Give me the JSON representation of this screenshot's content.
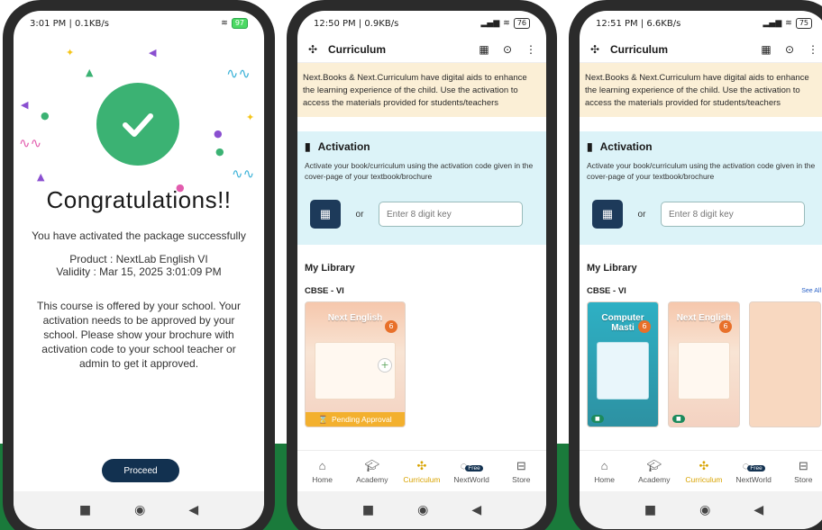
{
  "phone1": {
    "status_time": "3:01 PM | 0.1KB/s",
    "battery": "97",
    "heading": "Congratulations!!",
    "success_text": "You have activated the package successfully",
    "product_line": "Product : NextLab English VI",
    "validity_line": "Validity : Mar 15, 2025 3:01:09 PM",
    "approval_text": "This course is offered by your school. Your activation needs to be approved by your school. Please show your brochure with activation code to your school teacher or admin to get it approved.",
    "proceed_label": "Proceed"
  },
  "phone2": {
    "status_time": "12:50 PM | 0.9KB/s",
    "battery": "76"
  },
  "phone3": {
    "status_time": "12:51 PM | 6.6KB/s",
    "battery": "75"
  },
  "app": {
    "title": "Curriculum",
    "info_banner": "Next.Books & Next.Curriculum have digital aids to enhance the learning experience of the child. Use the activation to access the materials provided for students/teachers",
    "activation_title": "Activation",
    "activation_desc": "Activate your book/curriculum using the activation code given in the cover-page of your textbook/brochure",
    "or_label": "or",
    "key_placeholder": "Enter 8 digit key",
    "library_title": "My Library",
    "cbse_label": "CBSE - VI",
    "see_all": "See All",
    "pending_label": "Pending Approval",
    "book_next_english": "Next English",
    "book_computer_masti": "Computer Masti",
    "grade": "6",
    "tabs": [
      "Home",
      "Academy",
      "Curriculum",
      "NextWorld",
      "Store"
    ],
    "free_badge": "Free",
    "active_color": "#d8a300"
  },
  "icons": {
    "nav_square": "■",
    "nav_circle": "◉",
    "nav_back": "◀"
  }
}
